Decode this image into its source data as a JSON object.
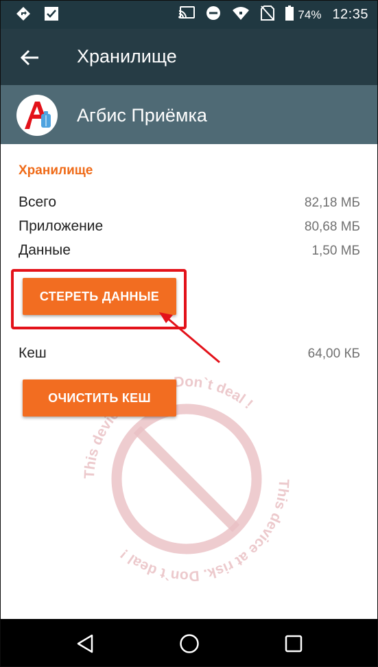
{
  "status_bar": {
    "battery": "74%",
    "time": "12:35",
    "icons": [
      "navigation-icon",
      "checkbox-notification-icon",
      "cast-icon",
      "do-not-disturb-icon",
      "wifi-icon",
      "no-sim-icon",
      "battery-icon"
    ]
  },
  "app_bar": {
    "title": "Хранилище"
  },
  "app_header": {
    "name": "Агбис Приёмка"
  },
  "storage": {
    "section_title": "Хранилище",
    "rows": [
      {
        "label": "Всего",
        "value": "82,18 МБ"
      },
      {
        "label": "Приложение",
        "value": "80,68 МБ"
      },
      {
        "label": "Данные",
        "value": "1,50 МБ"
      }
    ],
    "clear_data_label": "СТЕРЕТЬ ДАННЫЕ"
  },
  "cache": {
    "label": "Кеш",
    "value": "64,00 КБ",
    "clear_cache_label": "ОЧИСТИТЬ КЕШ"
  },
  "watermark": {
    "text": "This device at risk. Don`t deal !"
  },
  "colors": {
    "status_bar": "#203841",
    "app_bar": "#263c45",
    "app_header": "#4f6a75",
    "accent": "#f26d21",
    "section_title": "#ef6a17",
    "annotation": "#e3121a"
  }
}
